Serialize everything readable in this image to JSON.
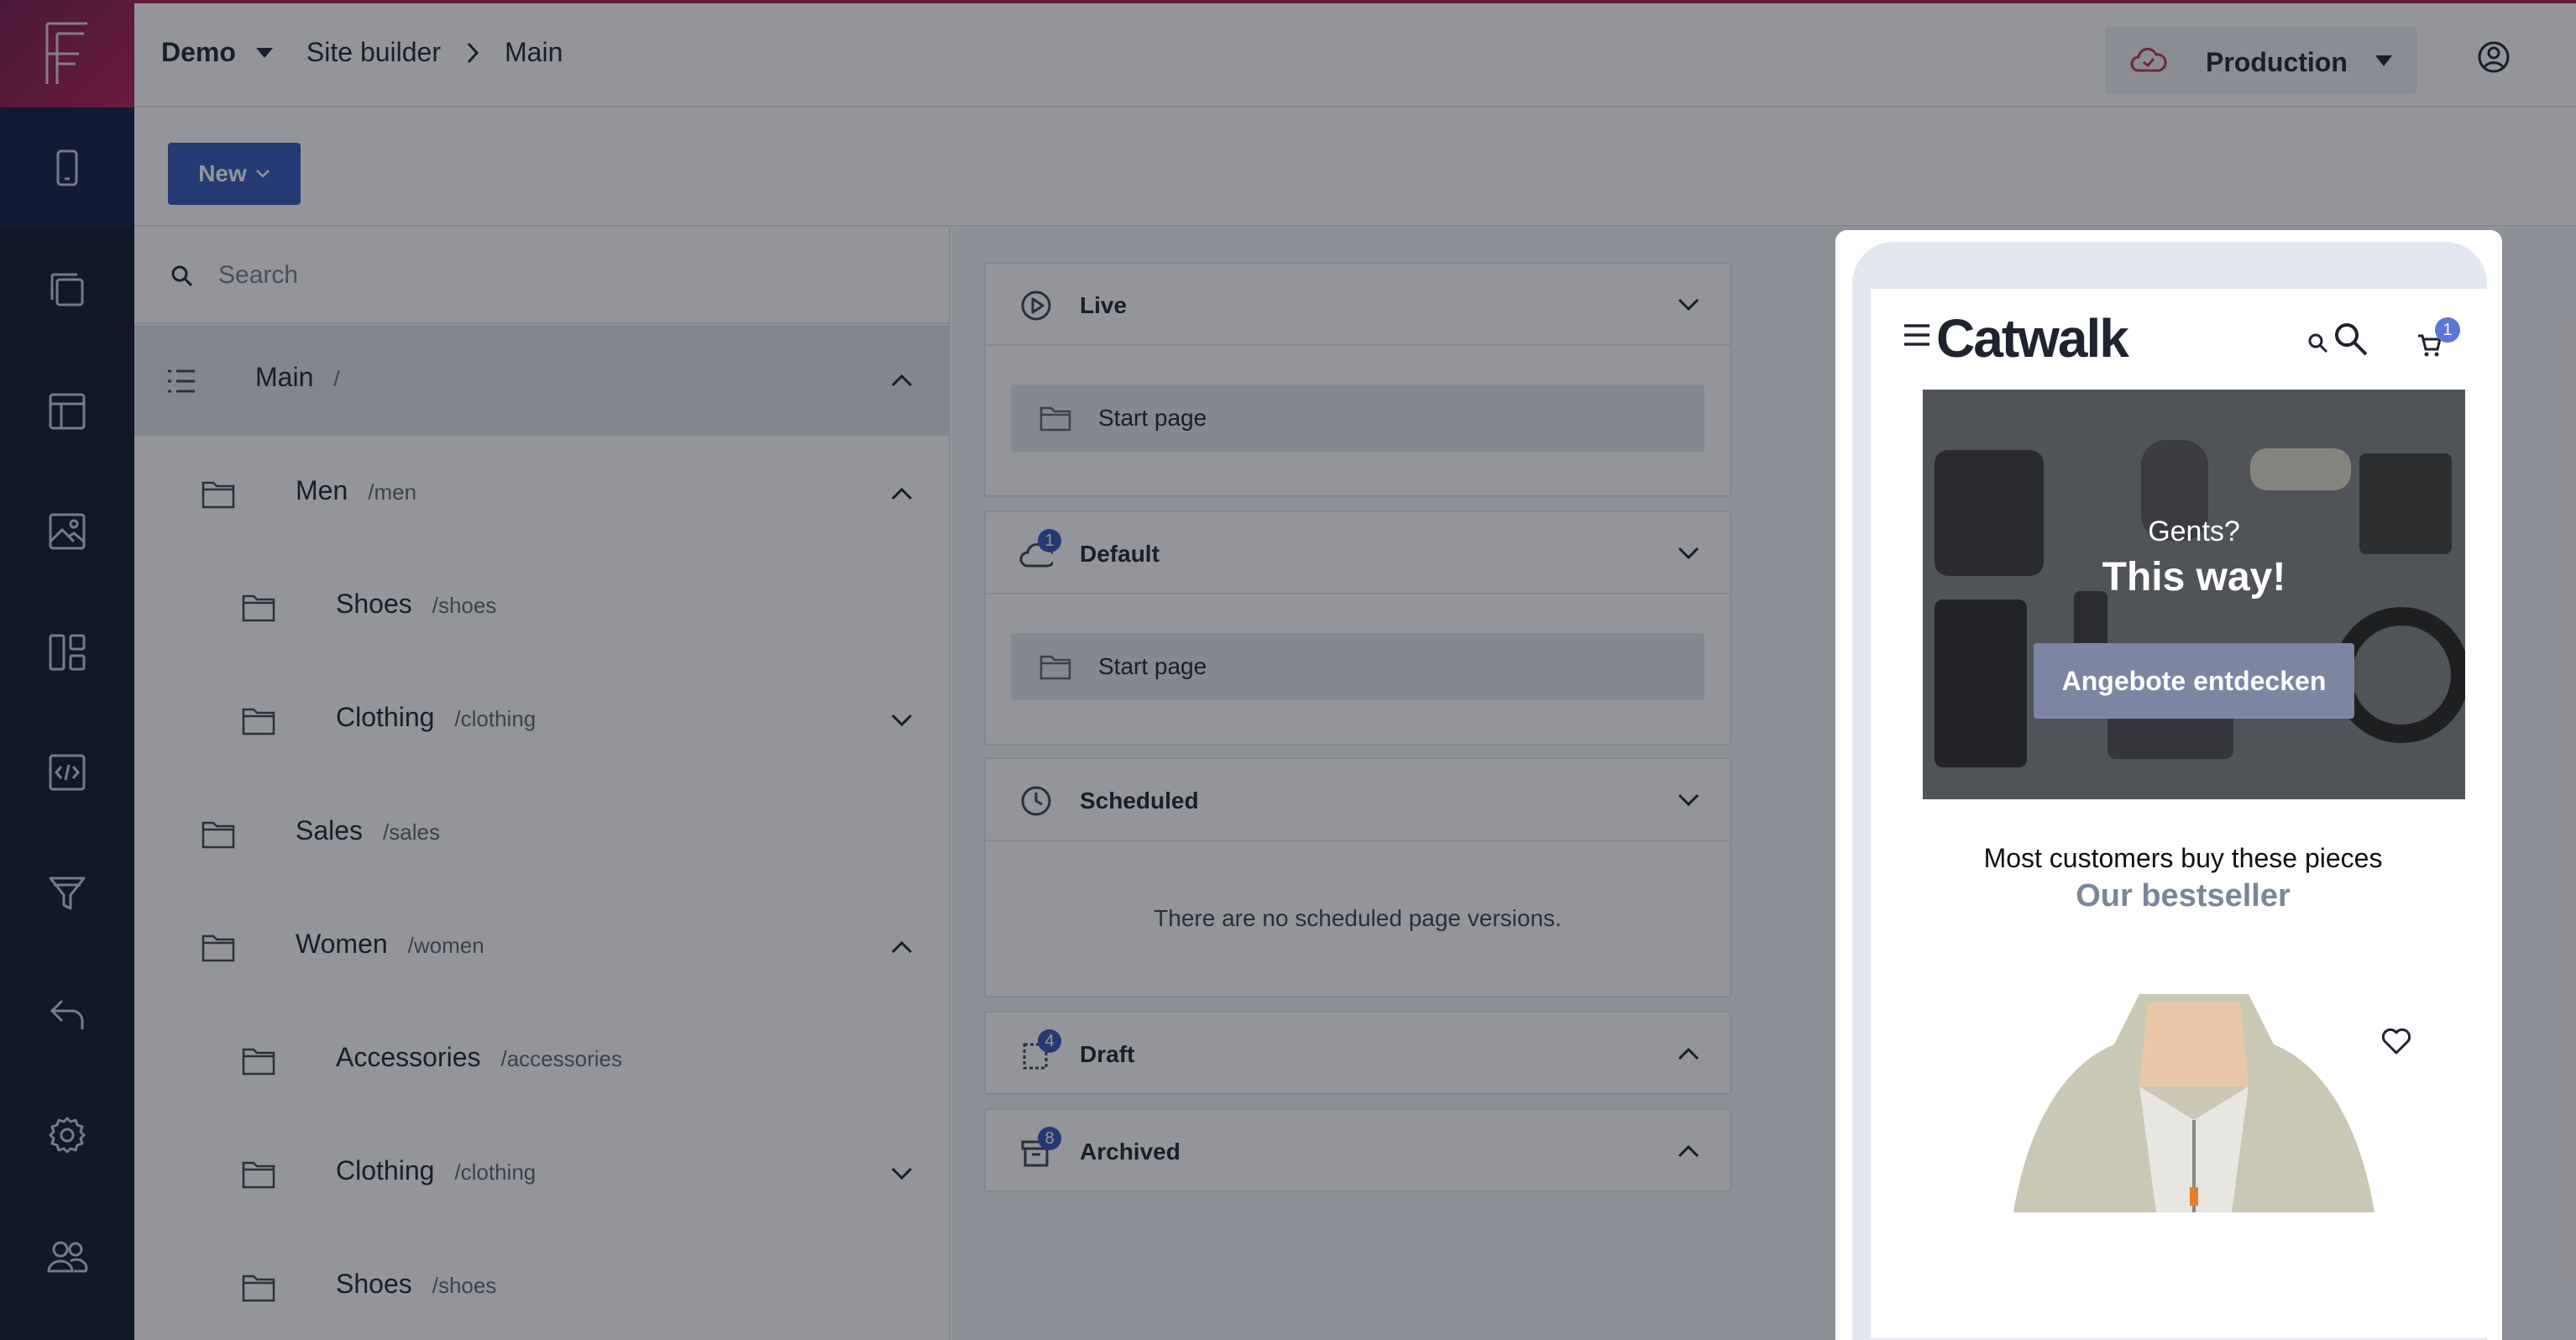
{
  "header": {
    "project": "Demo",
    "breadcrumb": [
      "Site builder",
      "Main"
    ],
    "environment": "Production"
  },
  "toolbar": {
    "new_label": "New"
  },
  "search": {
    "placeholder": "Search"
  },
  "tree": [
    {
      "name": "Main",
      "path": "/",
      "level": 0,
      "icon": "list-icon",
      "toggle": "up",
      "selected": true
    },
    {
      "name": "Men",
      "path": "/men",
      "level": 1,
      "icon": "folder-icon",
      "toggle": "up"
    },
    {
      "name": "Shoes",
      "path": "/shoes",
      "level": 2,
      "icon": "folder-icon",
      "toggle": ""
    },
    {
      "name": "Clothing",
      "path": "/clothing",
      "level": 2,
      "icon": "folder-icon",
      "toggle": "down"
    },
    {
      "name": "Sales",
      "path": "/sales",
      "level": 1,
      "icon": "folder-icon",
      "toggle": ""
    },
    {
      "name": "Women",
      "path": "/women",
      "level": 1,
      "icon": "folder-icon",
      "toggle": "up"
    },
    {
      "name": "Accessories",
      "path": "/accessories",
      "level": 2,
      "icon": "folder-icon",
      "toggle": ""
    },
    {
      "name": "Clothing",
      "path": "/clothing",
      "level": 2,
      "icon": "folder-icon",
      "toggle": "down"
    },
    {
      "name": "Shoes",
      "path": "/shoes",
      "level": 2,
      "icon": "folder-icon",
      "toggle": ""
    }
  ],
  "versions": {
    "live": {
      "title": "Live",
      "item": "Start page"
    },
    "default": {
      "title": "Default",
      "badge": "1",
      "item": "Start page"
    },
    "scheduled": {
      "title": "Scheduled",
      "empty": "There are no scheduled page versions."
    },
    "draft": {
      "title": "Draft",
      "badge": "4"
    },
    "archived": {
      "title": "Archived",
      "badge": "8"
    }
  },
  "preview": {
    "logo": "Catwalk",
    "cart_count": "1",
    "hero_line1": "Gents?",
    "hero_line2": "This way!",
    "hero_cta": "Angebote entdecken",
    "section_intro": "Most customers buy these pieces",
    "section_title": "Our bestseller"
  },
  "sidebar": {
    "icons": [
      "mobile-icon",
      "pages-icon",
      "layout-icon",
      "image-icon",
      "dashboard-icon",
      "code-icon",
      "filter-icon",
      "undo-icon",
      "settings-icon",
      "users-icon"
    ]
  },
  "colors": {
    "accent": "#3557b6",
    "brand": "#b01e58",
    "rail": "#0e1830"
  }
}
